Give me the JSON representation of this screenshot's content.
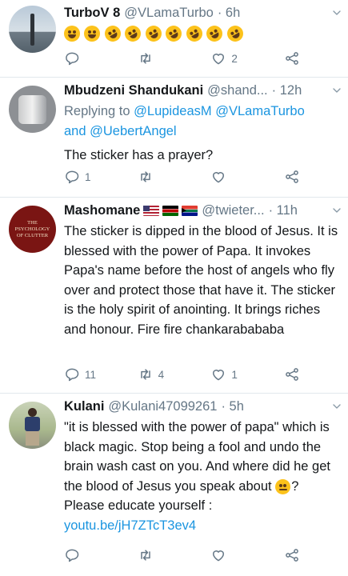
{
  "tweets": [
    {
      "name": "TurboV 8",
      "handle": "@VLamaTurbo",
      "time": "· 6h",
      "emoji_row": [
        "face-with-tears-of-joy",
        "face-with-tears-of-joy",
        "rolling-on-the-floor-laughing",
        "rolling-on-the-floor-laughing",
        "rolling-on-the-floor-laughing",
        "rolling-on-the-floor-laughing",
        "rolling-on-the-floor-laughing",
        "rolling-on-the-floor-laughing",
        "rolling-on-the-floor-laughing"
      ],
      "actions": {
        "reply": "",
        "retweet": "",
        "like": "2"
      }
    },
    {
      "name": "Mbudzeni Shandukani",
      "handle": "@shand...",
      "time": "· 12h",
      "replying_prefix": "Replying to",
      "replying_1": "@LupideasM",
      "replying_2": "@VLamaTurbo",
      "replying_and": "and",
      "replying_3": "@UebertAngel",
      "text": "The sticker has a prayer?",
      "actions": {
        "reply": "1",
        "retweet": "",
        "like": ""
      }
    },
    {
      "name": "Mashomane",
      "handle": "@twieter...",
      "time": "· 11h",
      "avatar_text": "THE PSYCHOLOGY OF CLUTTER",
      "flags": [
        "us-flag",
        "kenya-flag",
        "south-africa-flag"
      ],
      "text": "The sticker is dipped in the blood of Jesus. It is blessed with the power of Papa. It invokes Papa's name before the host of angels who fly over and protect those that have it. The sticker is the holy spirit of anointing. It brings riches and honour. Fire fire chankarabababa",
      "actions": {
        "reply": "11",
        "retweet": "4",
        "like": "1"
      }
    },
    {
      "name": "Kulani",
      "handle": "@Kulani47099261",
      "time": "· 5h",
      "text_1": "\"it is blessed with the power of papa\" which is black magic. Stop being a fool and undo the brain wash cast on you. And where did he get the blood of Jesus you speak about",
      "thinking_emoji": "thinking-face",
      "text_2": "? Please educate yourself :",
      "link": "youtu.be/jH7ZTcT3ev4",
      "actions": {
        "reply": "",
        "retweet": "",
        "like": ""
      }
    }
  ],
  "colors": {
    "link": "#1b95e0",
    "muted": "#657786",
    "border": "#e1e8ed"
  }
}
